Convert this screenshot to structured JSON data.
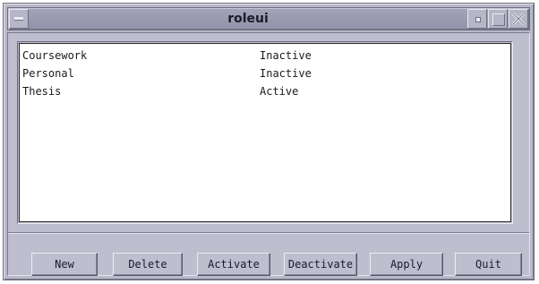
{
  "window": {
    "title": "roleui"
  },
  "roles": [
    {
      "name": "Coursework",
      "status": "Inactive"
    },
    {
      "name": "Personal",
      "status": "Inactive"
    },
    {
      "name": "Thesis",
      "status": "Active"
    }
  ],
  "buttons": {
    "new": "New",
    "delete": "Delete",
    "activate": "Activate",
    "deactivate": "Deactivate",
    "apply": "Apply",
    "quit": "Quit"
  },
  "colors": {
    "window_bg": "#bebece",
    "titlebar_bg": "#9a9ab0",
    "list_bg": "#ffffff"
  }
}
